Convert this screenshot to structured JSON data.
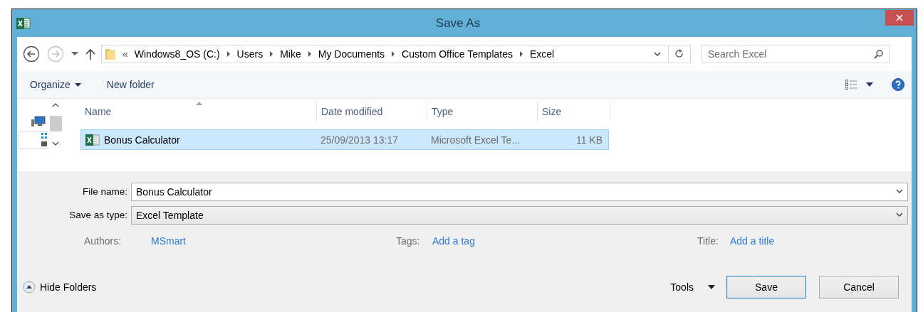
{
  "window": {
    "title": "Save As"
  },
  "address_bar": {
    "overflow": "«",
    "crumbs": [
      "Windows8_OS (C:)",
      "Users",
      "Mike",
      "My Documents",
      "Custom Office Templates",
      "Excel"
    ]
  },
  "search": {
    "placeholder": "Search Excel"
  },
  "toolbar": {
    "organize": "Organize",
    "new_folder": "New folder"
  },
  "file_list": {
    "columns": [
      {
        "label": "Name",
        "sorted": true
      },
      {
        "label": "Date modified",
        "sorted": false
      },
      {
        "label": "Type",
        "sorted": false
      },
      {
        "label": "Size",
        "sorted": false
      }
    ],
    "rows": [
      {
        "name": "Bonus Calculator",
        "date_modified": "25/09/2013 13:17",
        "type": "Microsoft Excel Te...",
        "size": "11 KB",
        "selected": true
      }
    ]
  },
  "fields": [
    {
      "label": "File name:",
      "value": "Bonus Calculator",
      "kind": "input"
    },
    {
      "label": "Save as type:",
      "value": "Excel Template",
      "kind": "select"
    }
  ],
  "metadata": [
    {
      "label": "Authors:",
      "value": "MSmart"
    },
    {
      "label": "Tags:",
      "value": "Add a tag"
    },
    {
      "label": "Title:",
      "value": "Add a title"
    }
  ],
  "hide_folders": "Hide Folders",
  "tools": "Tools",
  "buttons": [
    {
      "label": "Save",
      "default": true
    },
    {
      "label": "Cancel",
      "default": false
    }
  ]
}
